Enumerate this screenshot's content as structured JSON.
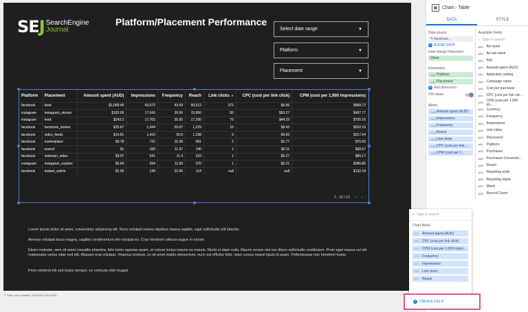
{
  "logo": {
    "brand": "SE",
    "brand_j": "J",
    "line1": "SearchEngine",
    "line2": "Journal"
  },
  "report": {
    "title": "Platform/Placement Performance"
  },
  "dropdowns": {
    "date": "Select date range",
    "platform": "Platform",
    "placement": "Placement"
  },
  "table": {
    "headers": [
      "Platform",
      "Placement",
      "Amount spent (AUD)",
      "Impressions",
      "Frequency",
      "Reach",
      "Link clicks",
      "CPC (cost per link click)",
      "CPM (cost per 1,000 impressions)"
    ],
    "sort_arrow": "▼",
    "rows": [
      [
        "facebook",
        "feed",
        "$1,089.45",
        "59,072",
        "43.59",
        "50,512",
        "373",
        "$6.56",
        "$868.72"
      ],
      [
        "instagram",
        "instagram_stories",
        "$182.09",
        "17,045",
        "36.06",
        "15,866",
        "83",
        "$50.27",
        "$467.77"
      ],
      [
        "instagram",
        "feed",
        "$243.2",
        "17,765",
        "35.95",
        "17,290",
        "75",
        "$44.29",
        "$705.16"
      ],
      [
        "facebook",
        "facebook_stories",
        "$25.67",
        "1,344",
        "29.07",
        "1,229",
        "10",
        "$8.43",
        "$552.16"
      ],
      [
        "facebook",
        "video_feeds",
        "$14.81",
        "1,410",
        "30.8",
        "1,298",
        "9",
        "$4.93",
        "$317.04"
      ],
      [
        "facebook",
        "marketplace",
        "$3.78",
        "722",
        "15.28",
        "681",
        "2",
        "$1.77",
        "$70.93"
      ],
      [
        "facebook",
        "search",
        "$1",
        "189",
        "11.97",
        "140",
        "1",
        "$0.11",
        "$38.57"
      ],
      [
        "facebook",
        "instream_video",
        "$3.07",
        "541",
        "11.4",
        "533",
        "1",
        "$0.27",
        "$80.17"
      ],
      [
        "instagram",
        "instagram_explore",
        "$2.94",
        "394",
        "11.89",
        "370",
        "1",
        "$0.21",
        "$286.85"
      ],
      [
        "facebook",
        "instant_article",
        "$1.06",
        "149",
        "22.96",
        "114",
        "null",
        "null",
        "$132.18"
      ]
    ],
    "pager": "1 - 10 / 13",
    "prev": "‹",
    "next": "›"
  },
  "lorem": {
    "p1": "Lorem ipsum dolor sit amet, consectetur adipiscing elit. Nunc volutpat massa dapibus massa sagittis, eget sollicitudin elit lobortis.",
    "p2": "Aenean volutpat lacus magna, sagittis condimentum elit volutpat eu. Cras hendrerit ultrices augue in rutrum.",
    "p3": "Etiam molestie, sem sit amet convallis pharetra, felis tortor egestas quam, at rutrum lectus mauris eu mauris. Morbi et diam nulla. Mauris ornare nisi nec libero sollicitudin vestibulum. Proin eget massa vel elit malesuada varius vitae sed elit. Aliquam erat volutpat. Vivamus pretium, ex sit amet mattis elementum, nunc est efficitur felis, vitae cursus neque ligula id quam. Pellentesque non hendrerit turpis.",
    "p4": "Proin eleifend elit sed turpis semper, eu vehicula nibh feugiat."
  },
  "footer": "Data Last Updated: 01/06/2022 06:09:05",
  "panel": {
    "crumb": "Chart › Table",
    "tab_data": "DATA",
    "tab_style": "STYLE",
    "data_source_label": "Data source",
    "data_source": "facebook...",
    "blend": "BLEND DATA",
    "date_range_label": "Date Range Dimension",
    "date_range": "Week",
    "dimension_label": "Dimension",
    "dimensions": [
      "Platform",
      "Placement"
    ],
    "add_dimension": "Add dimension",
    "drill_label": "Drill down",
    "metric_label": "Metric",
    "metrics": [
      "Amount spent (AUD)",
      "Impressions",
      "Frequency",
      "Reach",
      "Link clicks",
      "CPC (cost per link...",
      "CPM (cost per 1,..."
    ],
    "available_label": "Available Fields",
    "search_placeholder": "Type to search",
    "fields": [
      "Ad name",
      "Ad set name",
      "Ads",
      "Amount spent (AUD)",
      "Attribution setting",
      "Campaign name",
      "Cost per purchase",
      "CPC (cost per link clic...",
      "CPM (cost per 1,000 im...",
      "Currency",
      "Frequency",
      "Impressions",
      "Link clicks",
      "Placement",
      "Platform",
      "Purchases",
      "Purchases Conversio...",
      "Reach",
      "Reporting ends",
      "Reporting starts",
      "Week",
      "Record Count"
    ]
  },
  "popup": {
    "search": "Type to search",
    "label": "Chart fields",
    "items": [
      "Amount spent (AUD)",
      "CPC (cost per link click)",
      "CPM (cost per 1,000 impre...",
      "Frequency",
      "Impressions",
      "Link clicks",
      "Reach"
    ],
    "create": "CREATE FIELD"
  }
}
